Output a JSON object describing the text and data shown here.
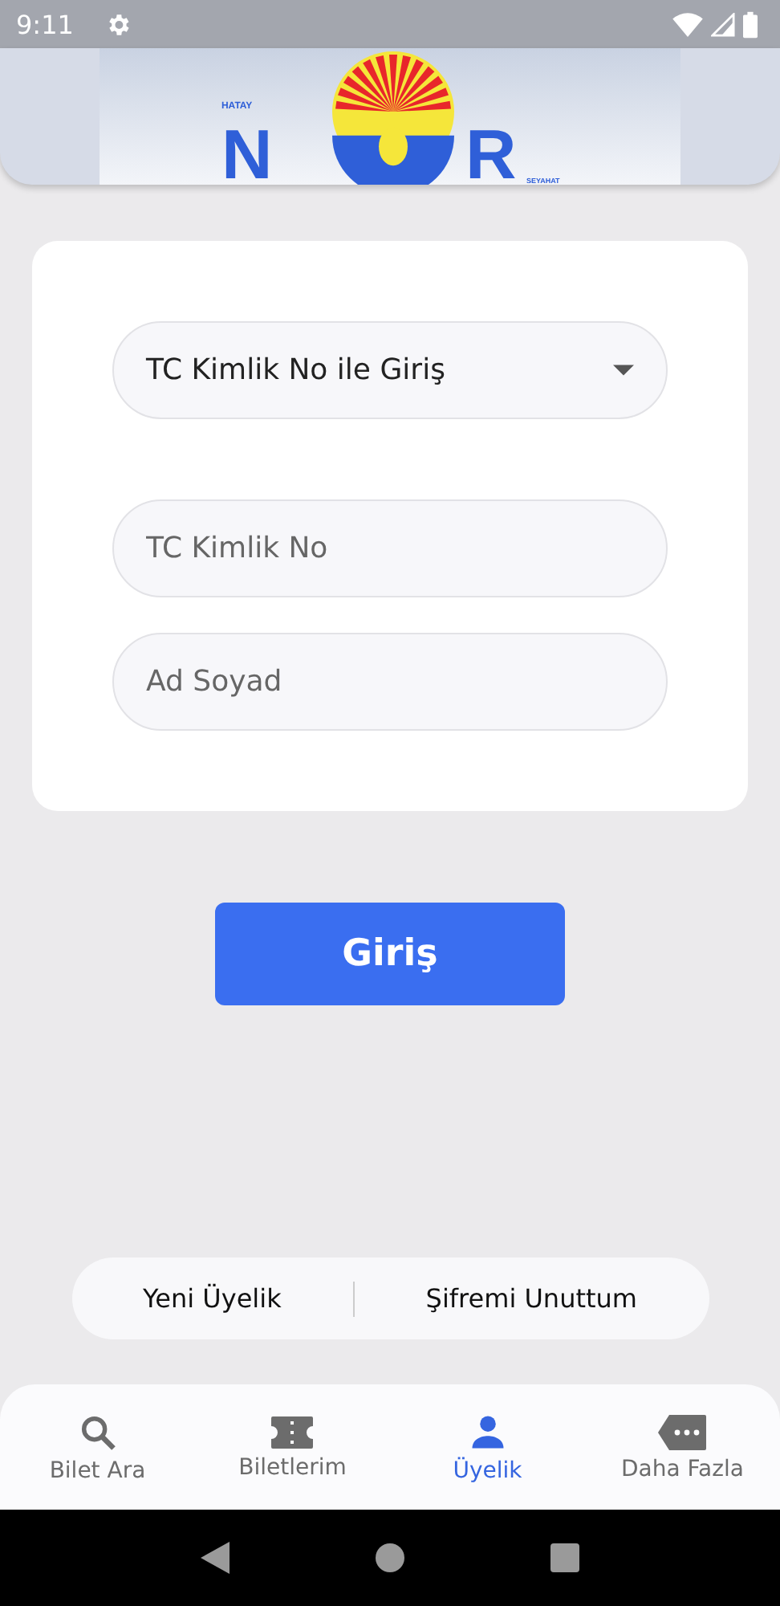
{
  "status_bar": {
    "time": "9:11"
  },
  "logo": {
    "top": "HATAY",
    "left": "N",
    "right": "R",
    "bottom": "SEYAHAT"
  },
  "login_type": {
    "value": "TC Kimlik No ile Giriş"
  },
  "fields": [
    {
      "placeholder": "TC Kimlik No"
    },
    {
      "placeholder": "Ad Soyad"
    }
  ],
  "submit": "Giriş",
  "links": [
    "Yeni Üyelik",
    "Şifremi Unuttum"
  ],
  "nav": [
    {
      "label": "Bilet Ara",
      "kind": "search",
      "selected": false
    },
    {
      "label": "Biletlerim",
      "kind": "ticket",
      "selected": false
    },
    {
      "label": "Üyelik",
      "kind": "person",
      "selected": true
    },
    {
      "label": "Daha Fazla",
      "kind": "more",
      "selected": false
    }
  ]
}
